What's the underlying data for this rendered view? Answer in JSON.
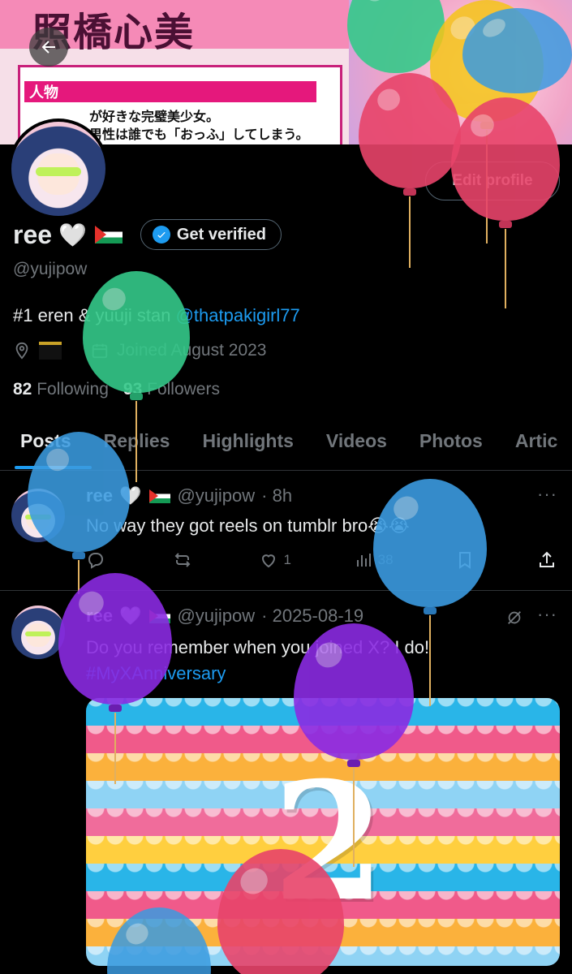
{
  "banner": {
    "title": "照橋心美",
    "section_tag": "人物",
    "line1": "が好きな完璧美少女。",
    "line2": "男性は誰でも「おっふ」してしまう。"
  },
  "nav": {
    "back_label": "Back"
  },
  "profile": {
    "name": "ree",
    "name_heart": "🤍",
    "verify_label": "Get verified",
    "edit_label": "Edit profile",
    "handle": "@yujipow",
    "bio_text": "#1 eren & yuuji stan ",
    "bio_link": "@thatpakigirl77",
    "joined": "Joined August 2023",
    "following_count": "82",
    "following_label": "Following",
    "followers_count": "93",
    "followers_label": "Followers"
  },
  "tabs": [
    "Posts",
    "Replies",
    "Highlights",
    "Videos",
    "Photos",
    "Artic"
  ],
  "posts": [
    {
      "name": "ree",
      "heart": "🤍",
      "handle": "@yujipow",
      "time": "· 8h",
      "text": "No way they got reels on tumblr bro😭😭",
      "replies": "",
      "reposts": "",
      "likes": "1",
      "views": "38"
    },
    {
      "name": "ree",
      "heart": "🤍",
      "handle": "@yujipow",
      "time": "· 2025-08-19",
      "text": "Do you remember when you joined X? I do!",
      "hashtag": "#MyXAnniversary",
      "media_text": "2"
    }
  ],
  "colors": {
    "accent": "#1d9bf0",
    "muted": "#71767b",
    "divider": "#2f3336",
    "balloon_green": "#35c98a",
    "balloon_blue": "#3b9be0",
    "balloon_purple": "#8a2be2",
    "balloon_red": "#e8446a",
    "balloon_yellow": "#f5c518"
  }
}
